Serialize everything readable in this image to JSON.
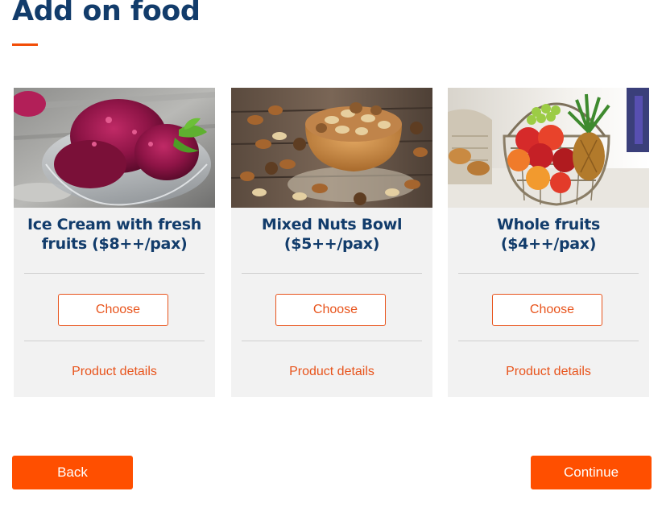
{
  "page": {
    "title": "Add on food"
  },
  "products": [
    {
      "name": "Ice Cream with fresh fruits ($8++/pax)",
      "image_icon": "ice-cream-icon",
      "choose_label": "Choose",
      "details_label": "Product details"
    },
    {
      "name": "Mixed Nuts Bowl ($5++/pax)",
      "image_icon": "nuts-bowl-icon",
      "choose_label": "Choose",
      "details_label": "Product details"
    },
    {
      "name": "Whole fruits ($4++/pax)",
      "image_icon": "fruit-basket-icon",
      "choose_label": "Choose",
      "details_label": "Product details"
    }
  ],
  "navigation": {
    "back_label": "Back",
    "continue_label": "Continue"
  },
  "colors": {
    "title": "#123c6b",
    "accent": "#ff4f00",
    "card_background": "#f2f2f2"
  }
}
